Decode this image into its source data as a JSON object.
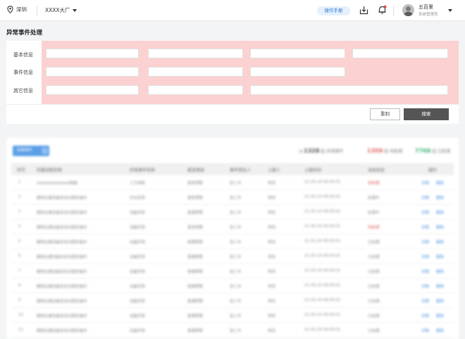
{
  "header": {
    "location": "深圳",
    "factory": "XXXX大厂",
    "manual_button": "操作手册",
    "user_name": "五百里",
    "user_role": "系统管理员"
  },
  "page_title": "异常事件处理",
  "form": {
    "labels": [
      "基本信息",
      "事件信息",
      "其它信息"
    ],
    "reset_button": "重制",
    "search_button": "搜索"
  },
  "table": {
    "add_button": "新建事件",
    "stats": [
      {
        "value": "1328",
        "unit": "起",
        "label": "异常事件",
        "color": "#555555"
      },
      {
        "value": "1359",
        "unit": "起",
        "label": "待处理",
        "color": "#e05a5a"
      },
      {
        "value": "7768",
        "unit": "起",
        "label": "已处理",
        "color": "#3cb371"
      }
    ],
    "columns": [
      "序号",
      "所属流程名称",
      "异常事件名称",
      "紧急等级",
      "事件责任人",
      "上报人",
      "上报时间",
      "当前状态",
      "操作"
    ],
    "rows": [
      {
        "no": "1",
        "flow": "AAAAAAAAAAAA跨越",
        "name": "工艺参数",
        "level": "紧急预警",
        "owner": "张三丰",
        "reporter": "李四",
        "time": "21-05-20 09:05:01",
        "status": "待处理",
        "status_warn": true,
        "op1": "详情",
        "op2": "删除"
      },
      {
        "no": "2",
        "flow": "删除在建设备状态问题的操作",
        "name": "作业异常",
        "level": "紧急预警",
        "owner": "张三丰",
        "reporter": "李四",
        "time": "21-05-20 09:05:01",
        "status": "处理中",
        "status_warn": false,
        "op1": "详情",
        "op2": "删除"
      },
      {
        "no": "3",
        "flow": "删除在建设备状态问题的操作",
        "name": "设备异常",
        "level": "普通预警",
        "owner": "张三丰",
        "reporter": "李四",
        "time": "21-05-20 09:05:01",
        "status": "处理中",
        "status_warn": false,
        "op1": "详情",
        "op2": "删除"
      },
      {
        "no": "4",
        "flow": "删除在建设备状态问题的操作",
        "name": "设备异常",
        "level": "紧急预警",
        "owner": "张三丰",
        "reporter": "李四",
        "time": "21-05-20 09:05:01",
        "status": "待处理",
        "status_warn": true,
        "op1": "详情",
        "op2": "删除"
      },
      {
        "no": "5",
        "flow": "删除在建设备状态问题的操作",
        "name": "设备异常",
        "level": "普通预警",
        "owner": "张三丰",
        "reporter": "李四",
        "time": "21-05-20 09:05:01",
        "status": "已处理",
        "status_warn": false,
        "op1": "详情",
        "op2": "删除"
      },
      {
        "no": "6",
        "flow": "删除在建设备状态问题的操作",
        "name": "设备异常",
        "level": "普通预警",
        "owner": "张三丰",
        "reporter": "李四",
        "time": "21-05-20 09:05:01",
        "status": "已处理",
        "status_warn": false,
        "op1": "详情",
        "op2": "删除"
      },
      {
        "no": "7",
        "flow": "删除在建设备状态问题的操作",
        "name": "设备异常",
        "level": "普通预警",
        "owner": "张三丰",
        "reporter": "李四",
        "time": "21-05-20 09:05:01",
        "status": "已处理",
        "status_warn": false,
        "op1": "详情",
        "op2": "删除"
      },
      {
        "no": "8",
        "flow": "删除在建设备状态问题的操作",
        "name": "设备异常",
        "level": "普通预警",
        "owner": "张三丰",
        "reporter": "李四",
        "time": "21-05-20 09:05:01",
        "status": "已处理",
        "status_warn": false,
        "op1": "详情",
        "op2": "删除"
      },
      {
        "no": "9",
        "flow": "删除在建设备状态问题的操作",
        "name": "设备异常",
        "level": "普通预警",
        "owner": "张三丰",
        "reporter": "李四",
        "time": "21-05-20 09:05:01",
        "status": "已处理",
        "status_warn": false,
        "op1": "详情",
        "op2": "删除"
      },
      {
        "no": "10",
        "flow": "删除在建设备状态问题的操作",
        "name": "设备异常",
        "level": "普通预警",
        "owner": "张三丰",
        "reporter": "李四",
        "time": "21-05-20 09:05:01",
        "status": "已处理",
        "status_warn": false,
        "op1": "详情",
        "op2": "删除"
      },
      {
        "no": "11",
        "flow": "删除在建设备状态问题的操作",
        "name": "设备异常",
        "level": "普通预警",
        "owner": "张三丰",
        "reporter": "李四",
        "time": "21-05-20 09:05:01",
        "status": "已处理",
        "status_warn": false,
        "op1": "详情",
        "op2": "删除"
      }
    ]
  }
}
